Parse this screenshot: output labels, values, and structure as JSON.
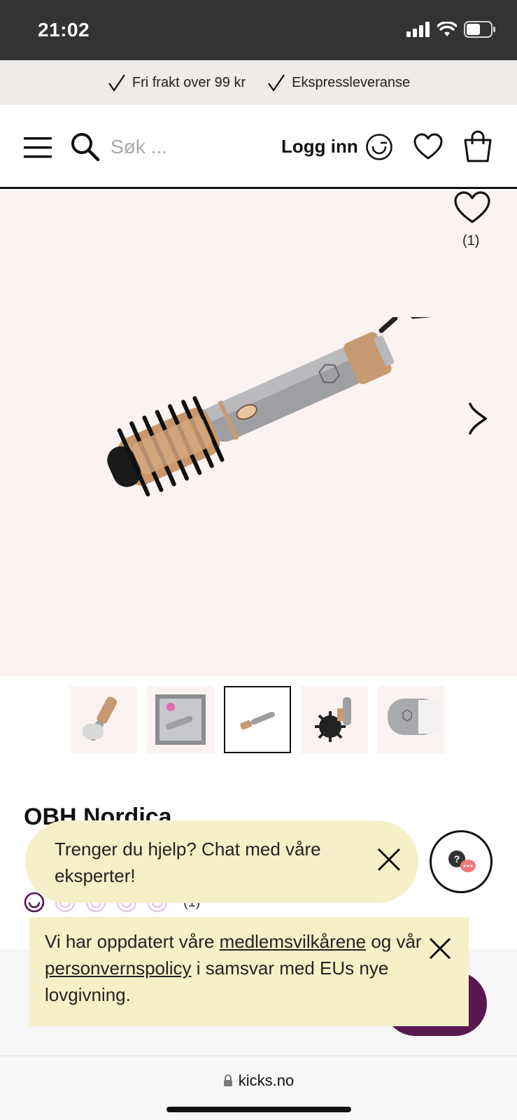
{
  "status_bar": {
    "time": "21:02"
  },
  "promo": {
    "items": [
      "Fri frakt over 99 kr",
      "Ekspressleveranse"
    ]
  },
  "header": {
    "search_placeholder": "Søk ...",
    "login_label": "Logg inn"
  },
  "product": {
    "favorite_count": "(1)",
    "brand": "OBH Nordica",
    "rating_count": "(1)",
    "rating": 1,
    "rating_max": 5
  },
  "thumbnails": {
    "count": 5,
    "active_index": 2
  },
  "chat": {
    "text": "Trenger du hjelp? Chat med våre eksperter!"
  },
  "notice": {
    "part1": "Vi har oppdatert våre ",
    "link1": "medlemsvilkårene",
    "part2": " og vår ",
    "link2": "personvernspolicy",
    "part3": " i samsvar med EUs nye lovgivning."
  },
  "browser": {
    "url": "kicks.no"
  },
  "colors": {
    "accent": "#5a1850",
    "hero_bg": "#fbf3f1",
    "notice_bg": "#f5f0c8"
  }
}
